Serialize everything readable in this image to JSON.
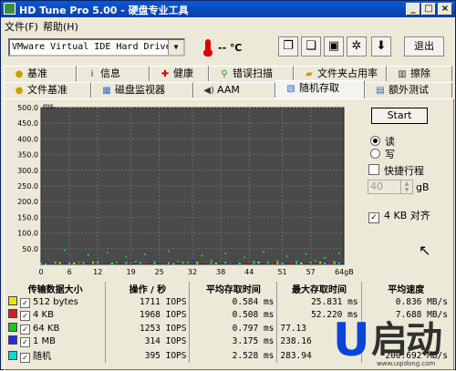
{
  "window": {
    "title": "HD Tune Pro 5.00 - 硬盘专业工具"
  },
  "menu": {
    "file": "文件(F)",
    "help": "帮助(H)"
  },
  "toolbar": {
    "drive": "VMware Virtual IDE Hard Drive (64",
    "temperature": "-- ℃",
    "exit_label": "退出",
    "tools": [
      "copy-info-icon",
      "copy-screenshot-icon",
      "save-icon",
      "options-icon",
      "download-icon"
    ]
  },
  "tabs_row1": [
    "基准",
    "信息",
    "健康",
    "错误扫描",
    "文件夹占用率",
    "擦除"
  ],
  "tabs_row2": [
    "文件基准",
    "磁盘监视器",
    "AAM",
    "随机存取",
    "额外测试"
  ],
  "active_tab": "随机存取",
  "options": {
    "start_label": "Start",
    "read_label": "读",
    "write_label": "写",
    "short_stroke_label": "快捷行程",
    "short_stroke_value": "40",
    "short_stroke_unit": "gB",
    "align_label": "4 KB 对齐",
    "mode": "read",
    "short_stroke_checked": false,
    "align_checked": true
  },
  "chart_data": {
    "type": "scatter",
    "ylabel": "ms",
    "xlabel": "64gB",
    "ylim": [
      0,
      500
    ],
    "xlim": [
      0,
      64
    ],
    "y_ticks": [
      "500.0",
      "450.0",
      "400.0",
      "350.0",
      "300.0",
      "250.0",
      "200.0",
      "150.0",
      "100.0",
      "50.0"
    ],
    "x_ticks": [
      "0",
      "6",
      "12",
      "19",
      "25",
      "32",
      "38",
      "44",
      "51",
      "57",
      "64gB"
    ],
    "background": "#4a4a4a",
    "grid": true,
    "series": [
      {
        "name": "512 bytes",
        "color": "#e6e600",
        "points": [
          [
            1,
            2
          ],
          [
            4,
            4
          ],
          [
            7,
            3
          ],
          [
            11,
            5
          ],
          [
            15,
            3
          ],
          [
            19,
            6
          ],
          [
            24,
            4
          ],
          [
            28,
            3
          ],
          [
            33,
            5
          ],
          [
            37,
            4
          ],
          [
            42,
            3
          ],
          [
            46,
            6
          ],
          [
            50,
            4
          ],
          [
            55,
            3
          ],
          [
            59,
            5
          ],
          [
            62,
            4
          ]
        ]
      },
      {
        "name": "4 KB",
        "color": "#d42020",
        "points": [
          [
            2,
            3
          ],
          [
            6,
            5
          ],
          [
            9,
            2
          ],
          [
            13,
            4
          ],
          [
            18,
            3
          ],
          [
            22,
            5
          ],
          [
            26,
            3
          ],
          [
            31,
            4
          ],
          [
            35,
            6
          ],
          [
            40,
            3
          ],
          [
            44,
            5
          ],
          [
            49,
            3
          ],
          [
            53,
            4
          ],
          [
            58,
            6
          ],
          [
            61,
            3
          ]
        ]
      },
      {
        "name": "64 KB",
        "color": "#1ec81e",
        "points": [
          [
            1,
            4
          ],
          [
            3,
            7
          ],
          [
            5,
            45
          ],
          [
            8,
            5
          ],
          [
            10,
            30
          ],
          [
            12,
            8
          ],
          [
            14,
            38
          ],
          [
            16,
            6
          ],
          [
            18,
            24
          ],
          [
            20,
            9
          ],
          [
            22,
            32
          ],
          [
            24,
            7
          ],
          [
            27,
            42
          ],
          [
            29,
            10
          ],
          [
            31,
            6
          ],
          [
            34,
            28
          ],
          [
            36,
            12
          ],
          [
            39,
            35
          ],
          [
            41,
            7
          ],
          [
            43,
            22
          ],
          [
            45,
            9
          ],
          [
            47,
            40
          ],
          [
            50,
            11
          ],
          [
            52,
            26
          ],
          [
            54,
            8
          ],
          [
            56,
            33
          ],
          [
            58,
            12
          ],
          [
            60,
            21
          ],
          [
            62,
            9
          ],
          [
            63,
            36
          ]
        ]
      },
      {
        "name": "1 MB",
        "color": "#2a2ae6",
        "points": [
          [
            1,
            6
          ],
          [
            5,
            9
          ],
          [
            9,
            7
          ],
          [
            14,
            12
          ],
          [
            19,
            8
          ],
          [
            23,
            10
          ],
          [
            28,
            6
          ],
          [
            32,
            11
          ],
          [
            37,
            9
          ],
          [
            41,
            7
          ],
          [
            46,
            12
          ],
          [
            51,
            8
          ],
          [
            55,
            10
          ],
          [
            60,
            9
          ],
          [
            63,
            7
          ]
        ]
      },
      {
        "name": "随机",
        "color": "#10d8d8",
        "points": [
          [
            0,
            3
          ],
          [
            3,
            4
          ],
          [
            6,
            3
          ],
          [
            9,
            5
          ],
          [
            12,
            4
          ],
          [
            15,
            3
          ],
          [
            18,
            5
          ],
          [
            21,
            4
          ],
          [
            24,
            3
          ],
          [
            27,
            4
          ],
          [
            30,
            5
          ],
          [
            33,
            3
          ],
          [
            36,
            4
          ],
          [
            39,
            5
          ],
          [
            42,
            3
          ],
          [
            45,
            4
          ],
          [
            48,
            5
          ],
          [
            51,
            3
          ],
          [
            54,
            4
          ],
          [
            57,
            5
          ],
          [
            60,
            3
          ],
          [
            63,
            4
          ]
        ]
      }
    ]
  },
  "results": {
    "headers": [
      "传输数据大小",
      "操作 / 秒",
      "平均存取时间",
      "最大存取时间",
      "平均速度"
    ],
    "rows": [
      {
        "label": "512 bytes",
        "color": "#e6e600",
        "ops": "1711 IOPS",
        "avg": "0.584 ms",
        "max": "25.831 ms",
        "speed": "0.836 MB/s"
      },
      {
        "label": "4 KB",
        "color": "#d42020",
        "ops": "1968 IOPS",
        "avg": "0.508 ms",
        "max": "52.220 ms",
        "speed": "7.688 MB/s"
      },
      {
        "label": "64 KB",
        "color": "#1ec81e",
        "ops": "1253 IOPS",
        "avg": "0.797 ms",
        "max": "77.13",
        "speed": ""
      },
      {
        "label": "1 MB",
        "color": "#2a2ae6",
        "ops": "314 IOPS",
        "avg": "3.175 ms",
        "max": "238.16",
        "speed": ""
      },
      {
        "label": "随机",
        "color": "#10d8d8",
        "ops": "395 IOPS",
        "avg": "2.528 ms",
        "max": "283.94",
        "speed": "200.692 MB/s"
      }
    ]
  },
  "watermark": {
    "glyph": "U",
    "text": "启动",
    "site": "www.uqidong.com"
  }
}
